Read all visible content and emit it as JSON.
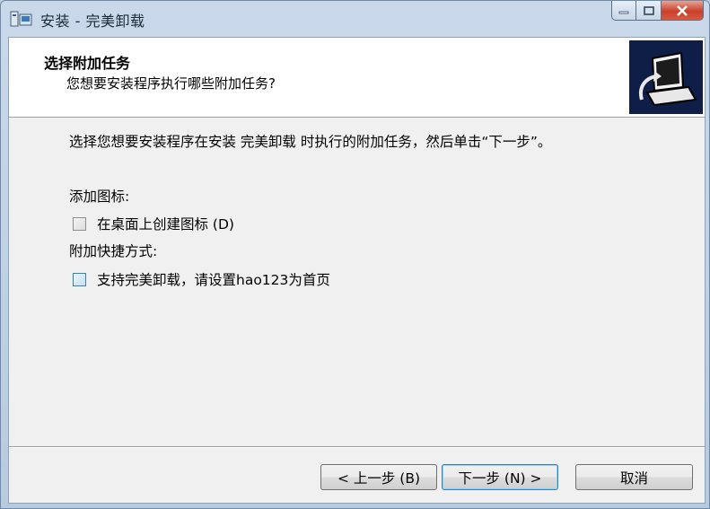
{
  "window": {
    "title": "安装 - 完美卸载",
    "icons": {
      "app": "installer-app-icon",
      "minimize": "minimize-icon",
      "maximize": "maximize-icon",
      "close": "close-icon"
    }
  },
  "header": {
    "title": "选择附加任务",
    "subtitle": "您想要安装程序执行哪些附加任务?",
    "image": "installer-computer-icon"
  },
  "body": {
    "description": "选择您想要安装程序在安装 完美卸载 时执行的附加任务，然后单击“下一步”。",
    "groups": [
      {
        "label": "添加图标:",
        "items": [
          {
            "label": "在桌面上创建图标 (D)",
            "checked": false
          }
        ]
      },
      {
        "label": "附加快捷方式:",
        "items": [
          {
            "label": "支持完美卸载，请设置hao123为首页",
            "checked": false
          }
        ]
      }
    ]
  },
  "footer": {
    "back": "< 上一步 (B)",
    "next": "下一步 (N) >",
    "cancel": "取消"
  },
  "colors": {
    "accent": "#3c7fb1",
    "close_red": "#c8402c",
    "header_bg": "#ffffff",
    "client_bg": "#f0f0f0"
  }
}
